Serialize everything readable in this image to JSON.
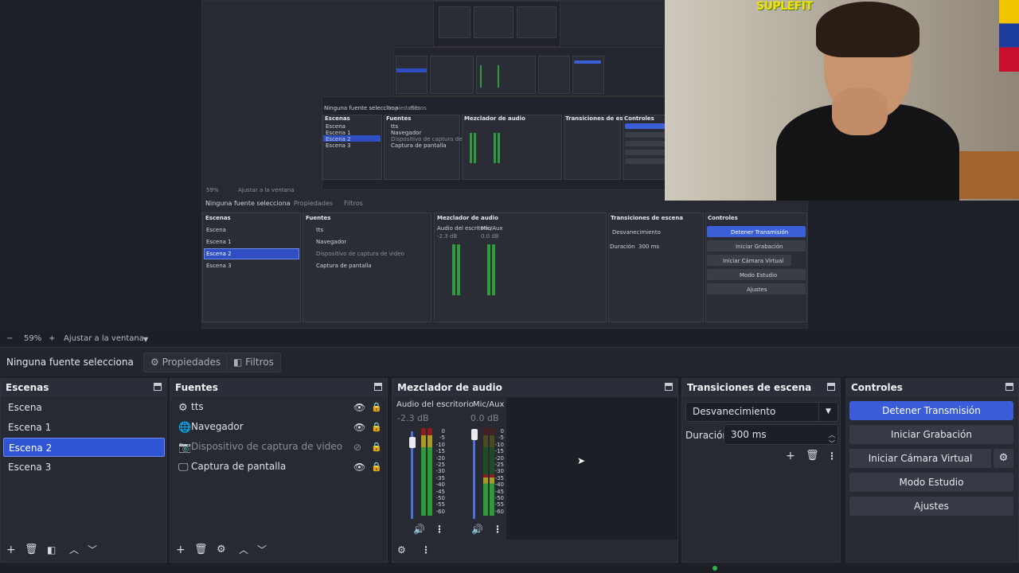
{
  "preview": {
    "webcam_logo": "SUPLEFIT",
    "nested": {
      "source_label": "Ninguna fuente selecciona",
      "props_label": "Propiedades",
      "filters_label": "Filtros",
      "zoom_label": "59%",
      "fit_label": "Ajustar a la ventana",
      "scenes_title": "Escenas",
      "sources_title": "Fuentes",
      "mixer_title": "Mezclador de audio",
      "transitions_title": "Transiciones de escena",
      "controls_title": "Controles",
      "scenes": [
        "Escena",
        "Escena 1",
        "Escena 2",
        "Escena 3"
      ],
      "sources": [
        "tts",
        "Navegador",
        "Dispositivo de captura de video",
        "Captura de pantalla"
      ],
      "chan1": "Audio del escritorio",
      "chan1_db": "-2.3 dB",
      "chan2": "Mic/Aux",
      "chan2_db": "0.0 dB",
      "transition": "Desvanecimiento",
      "duration_label": "Duración",
      "duration": "300 ms",
      "btn_stream": "Detener Transmisión",
      "btn_record": "Iniciar Grabación",
      "btn_vcam": "Iniciar Cámara Virtual",
      "btn_studio": "Modo Estudio",
      "btn_settings": "Ajustes"
    }
  },
  "zoombar": {
    "minus": "−",
    "zoom": "59%",
    "plus": "+",
    "fit": "Ajustar a la ventana",
    "fit_arrow": "▼"
  },
  "source_toolbar": {
    "label": "Ninguna fuente selecciona",
    "properties": "Propiedades",
    "filters": "Filtros"
  },
  "scenes_dock": {
    "title": "Escenas",
    "items": [
      "Escena",
      "Escena 1",
      "Escena 2",
      "Escena 3"
    ],
    "selected_index": 2
  },
  "sources_dock": {
    "title": "Fuentes",
    "items": [
      {
        "label": "tts",
        "icon": "gear-icon",
        "visible": true
      },
      {
        "label": "Navegador",
        "icon": "globe-icon",
        "visible": true
      },
      {
        "label": "Dispositivo de captura de video",
        "icon": "camera-icon",
        "visible": false
      },
      {
        "label": "Captura de pantalla",
        "icon": "monitor-icon",
        "visible": true
      }
    ]
  },
  "mixer_dock": {
    "title": "Mezclador de audio",
    "channels": [
      {
        "name": "Audio del escritorio",
        "db": "-2.3 dB"
      },
      {
        "name": "Mic/Aux",
        "db": "0.0 dB"
      }
    ],
    "scale": [
      "0",
      "-5",
      "-10",
      "-15",
      "-20",
      "-25",
      "-30",
      "-35",
      "-40",
      "-45",
      "-50",
      "-55",
      "-60"
    ]
  },
  "transitions_dock": {
    "title": "Transiciones de escena",
    "transition": "Desvanecimiento",
    "duration_label": "Duración",
    "duration": "300 ms"
  },
  "controls_dock": {
    "title": "Controles",
    "stream": "Detener Transmisión",
    "record": "Iniciar Grabación",
    "virtual_cam": "Iniciar Cámara Virtual",
    "studio": "Modo Estudio",
    "settings": "Ajustes"
  },
  "colors": {
    "accent": "#2f54d4",
    "primary_button": "#3a5cd8",
    "panel": "#272a33",
    "background": "#1d1f26"
  }
}
